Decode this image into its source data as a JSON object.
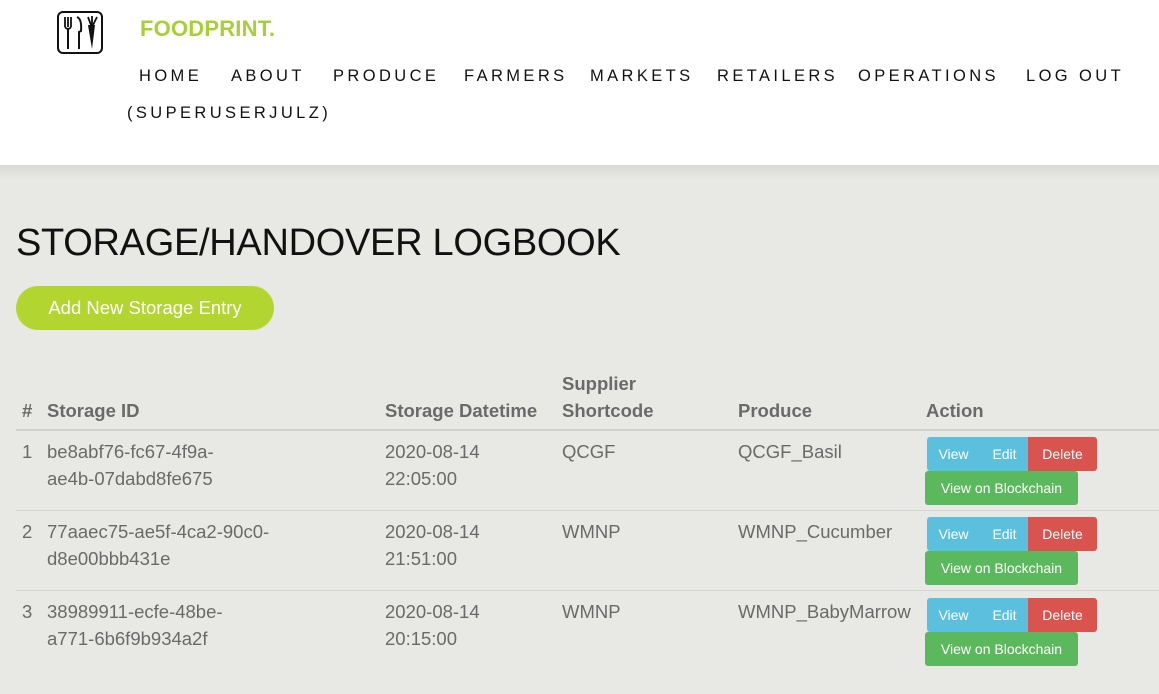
{
  "brand": {
    "name": "FOODPRINT."
  },
  "nav": {
    "items": [
      "HOME",
      "ABOUT",
      "PRODUCE",
      "FARMERS",
      "MARKETS",
      "RETAILERS",
      "OPERATIONS",
      "LOG OUT"
    ],
    "user": "(SUPERUSERJULZ)"
  },
  "page": {
    "title": "STORAGE/HANDOVER LOGBOOK",
    "add_button": "Add New Storage Entry"
  },
  "table": {
    "headers": {
      "num": "#",
      "storage_id": "Storage ID",
      "datetime": "Storage Datetime",
      "supplier_1": "Supplier",
      "supplier_2": "Shortcode",
      "produce": "Produce",
      "action": "Action"
    },
    "rows": [
      {
        "num": "1",
        "id_1": "be8abf76-fc67-4f9a-",
        "id_2": "ae4b-07dabd8fe675",
        "date": "2020-08-14",
        "time": "22:05:00",
        "supplier": "QCGF",
        "produce": "QCGF_Basil"
      },
      {
        "num": "2",
        "id_1": "77aaec75-ae5f-4ca2-90c0-",
        "id_2": "d8e00bbb431e",
        "date": "2020-08-14",
        "time": "21:51:00",
        "supplier": "WMNP",
        "produce": "WMNP_Cucumber"
      },
      {
        "num": "3",
        "id_1": "38989911-ecfe-48be-",
        "id_2": "a771-6b6f9b934a2f",
        "date": "2020-08-14",
        "time": "20:15:00",
        "supplier": "WMNP",
        "produce": "WMNP_BabyMarrow"
      }
    ],
    "actions": {
      "view": "View",
      "edit": "Edit",
      "delete": "Delete",
      "blockchain": "View on Blockchain"
    }
  },
  "colors": {
    "brand_green": "#a9cf38",
    "add_button": "#b2d62f",
    "info_blue": "#5bc0de",
    "danger_red": "#d9534f",
    "success_green": "#5cb85c",
    "page_bg": "#e8e8e4"
  }
}
